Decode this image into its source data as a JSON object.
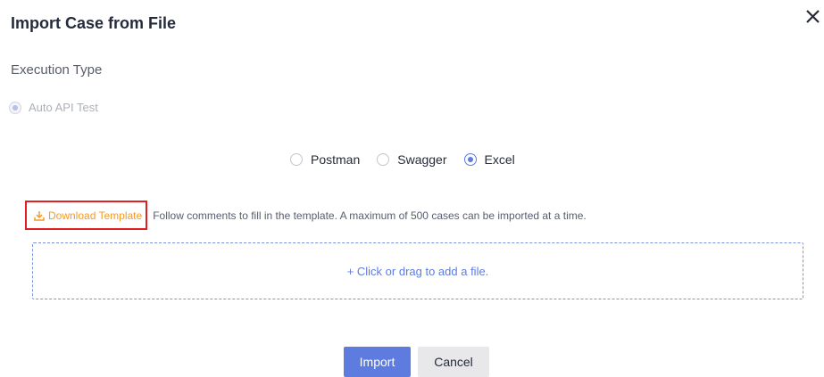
{
  "dialog": {
    "title": "Import Case from File"
  },
  "execution": {
    "label": "Execution Type",
    "option": "Auto API Test",
    "selected": true,
    "disabled": true
  },
  "source": {
    "options": [
      "Postman",
      "Swagger",
      "Excel"
    ],
    "selected": "Excel"
  },
  "template": {
    "download_label": "Download Template",
    "hint": "Follow comments to fill in the template. A maximum of 500 cases can be imported at a time."
  },
  "upload": {
    "prompt": "+ Click or drag to add a file."
  },
  "footer": {
    "import_label": "Import",
    "cancel_label": "Cancel"
  },
  "colors": {
    "accent": "#5e7ce0",
    "download_link": "#f59a23",
    "highlight_box": "#e02020"
  },
  "icons": {
    "close": "close-icon",
    "download": "download-icon"
  }
}
